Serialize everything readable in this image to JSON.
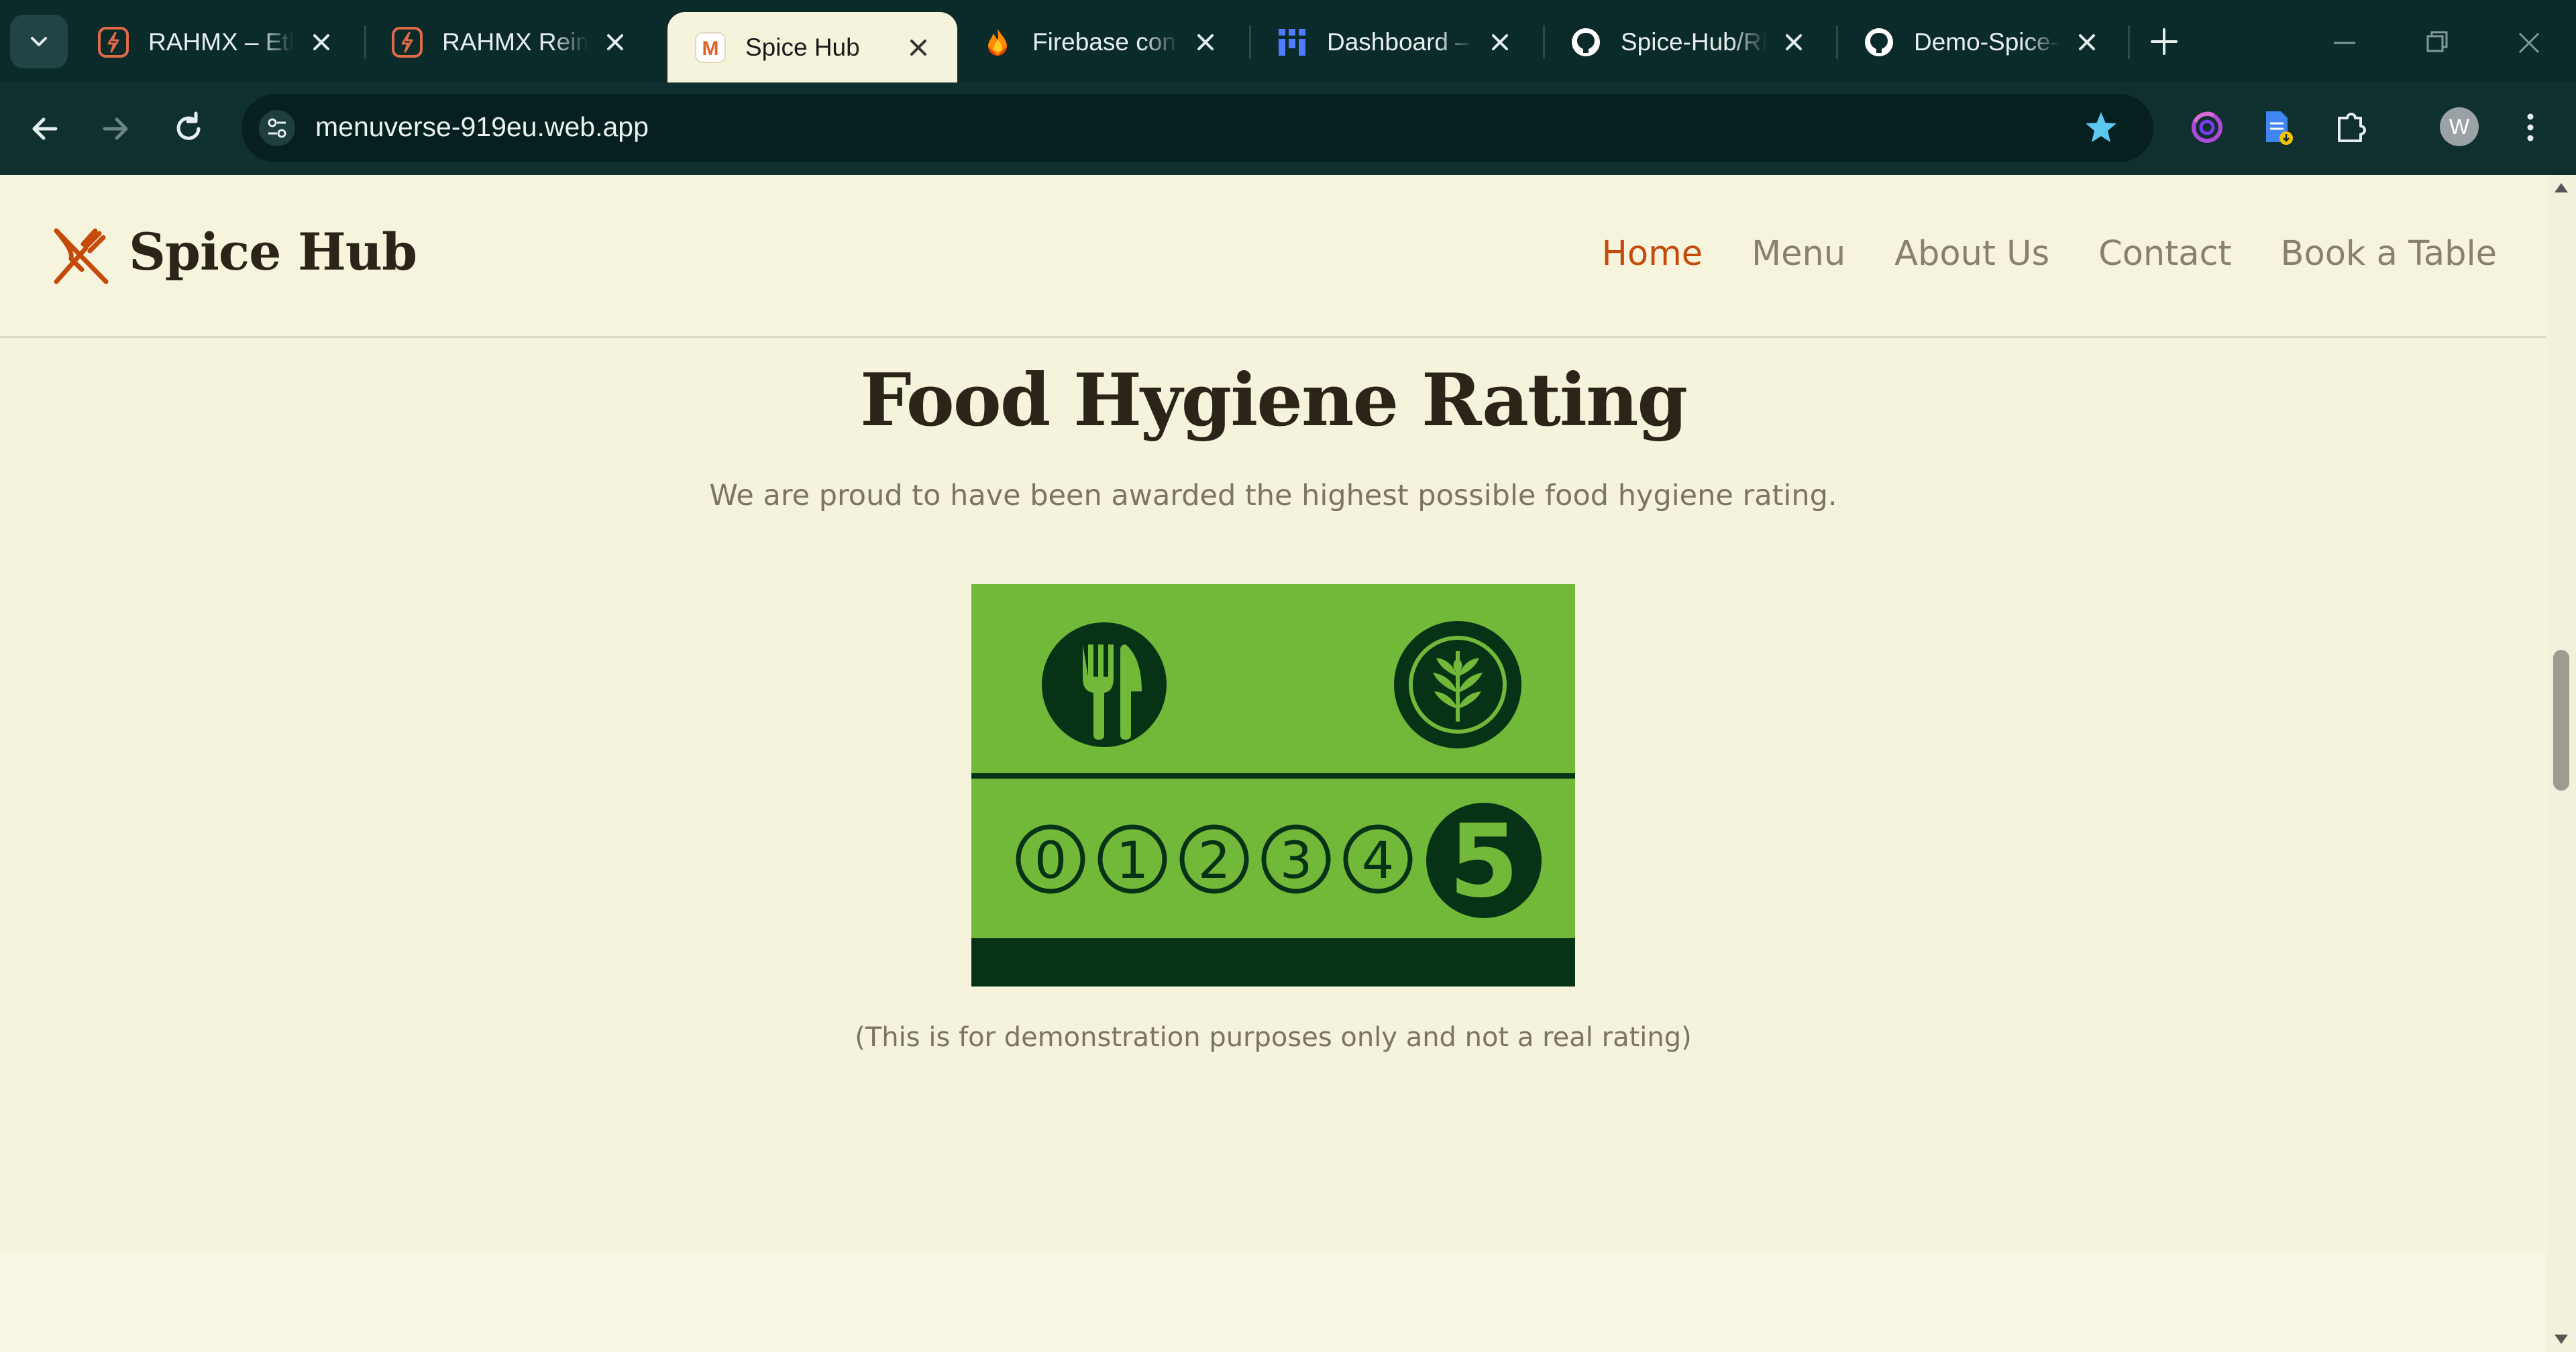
{
  "browser": {
    "tabs": [
      {
        "title": "RAHMX – Ethi",
        "favicon": "rahmx-icon",
        "active": false
      },
      {
        "title": "RAHMX Reima",
        "favicon": "rahmx-icon",
        "active": false
      },
      {
        "title": "Spice Hub",
        "favicon": "menuverse-icon",
        "active": true
      },
      {
        "title": "Firebase conso",
        "favicon": "firebase-icon",
        "active": false
      },
      {
        "title": "Dashboard – r",
        "favicon": "dashboard-icon",
        "active": false
      },
      {
        "title": "Spice-Hub/RE",
        "favicon": "github-icon",
        "active": false
      },
      {
        "title": "Demo-Spice-H",
        "favicon": "github-icon",
        "active": false
      }
    ],
    "url": "menuverse-919eu.web.app",
    "profile_initial": "W",
    "colors": {
      "tabstrip": "#0b2a2a",
      "toolbar": "#10302f",
      "star": "#5cc8f0"
    }
  },
  "site": {
    "brand": "Spice Hub",
    "logo": "fork-knife-icon",
    "nav": [
      {
        "label": "Home",
        "active": true
      },
      {
        "label": "Menu",
        "active": false
      },
      {
        "label": "About Us",
        "active": false
      },
      {
        "label": "Contact",
        "active": false
      },
      {
        "label": "Book a Table",
        "active": false
      }
    ],
    "accent": "#c44b0c"
  },
  "hygiene": {
    "title": "Food Hygiene Rating",
    "subtitle": "We are proud to have been awarded the highest possible food hygiene rating.",
    "badge": {
      "scale": [
        "0",
        "1",
        "2",
        "3",
        "4",
        "5"
      ],
      "rating": "5",
      "colors": {
        "green": "#72b93a",
        "dark": "#063316"
      }
    },
    "disclaimer": "(This is for demonstration purposes only and not a real rating)"
  }
}
